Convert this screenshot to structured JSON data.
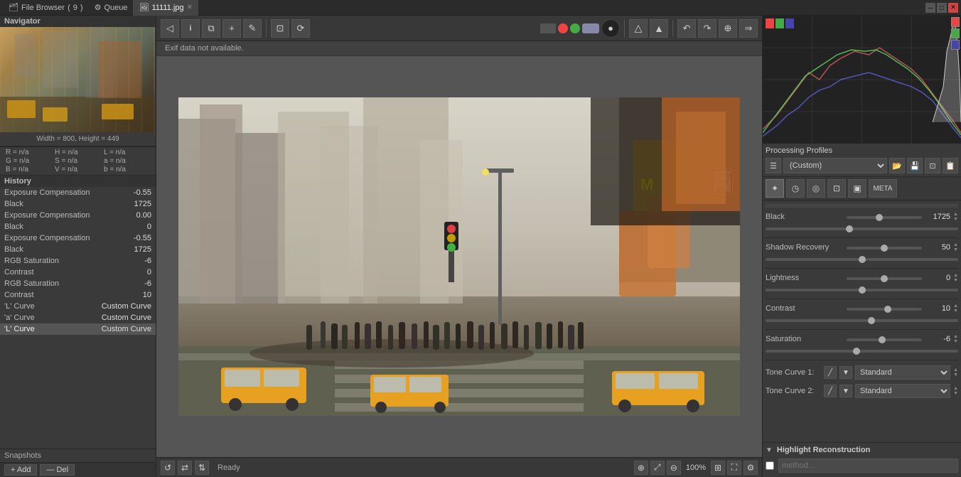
{
  "tabbar": {
    "items": [
      {
        "label": "File Browser",
        "icon": "folder-icon",
        "count": "9",
        "active": false
      },
      {
        "label": "Queue",
        "icon": "queue-icon",
        "active": false
      },
      {
        "label": "11111.jpg",
        "icon": "image-icon",
        "active": true,
        "closable": true
      }
    ]
  },
  "navigator": {
    "title": "Navigator",
    "width_label": "Width = 800, Height = 449"
  },
  "color_info": {
    "r_label": "R =",
    "r_val": "n/a",
    "h_label": "H =",
    "h_val": "n/a",
    "l_label": "L =",
    "l_val": "n/a",
    "g_label": "G =",
    "g_val": "n/a",
    "s_label": "S =",
    "s_val": "n/a",
    "a_label": "a =",
    "a_val": "n/a",
    "b_label": "B =",
    "b_val": "n/a",
    "v_label": "V =",
    "v_val": "n/a",
    "b2_label": "b =",
    "b2_val": "n/a"
  },
  "history": {
    "title": "History",
    "items": [
      {
        "label": "Exposure Compensation",
        "value": "-0.55",
        "active": false
      },
      {
        "label": "Black",
        "value": "1725",
        "active": false
      },
      {
        "label": "Exposure Compensation",
        "value": "0.00",
        "active": false
      },
      {
        "label": "Black",
        "value": "0",
        "active": false
      },
      {
        "label": "Exposure Compensation",
        "value": "-0.55",
        "active": false
      },
      {
        "label": "Black",
        "value": "1725",
        "active": false
      },
      {
        "label": "RGB Saturation",
        "value": "-6",
        "active": false
      },
      {
        "label": "Contrast",
        "value": "0",
        "active": false
      },
      {
        "label": "RGB Saturation",
        "value": "-6",
        "active": false
      },
      {
        "label": "Contrast",
        "value": "10",
        "active": false
      },
      {
        "label": "'L' Curve",
        "value": "Custom Curve",
        "active": false
      },
      {
        "label": "'a' Curve",
        "value": "Custom Curve",
        "active": false
      },
      {
        "label": "'L' Curve",
        "value": "Custom Curve",
        "active": true
      }
    ],
    "snapshots_label": "Snapshots",
    "add_btn": "+ Add",
    "del_btn": "— Del"
  },
  "toolbar": {
    "back_btn": "◁",
    "info_btn": "ℹ",
    "compare_btn": "⧉",
    "add_btn": "+",
    "edit_btn": "✎",
    "crop_btn": "⊡",
    "transform_btn": "⟳",
    "status": "Ready",
    "zoom_fit_btn": "⤢",
    "zoom_full_btn": "⊞",
    "zoom_pct": "100%"
  },
  "exif": {
    "text": "Exif data not available."
  },
  "right_panel": {
    "processing_profiles": {
      "title": "Processing Profiles",
      "current": "(Custom)"
    },
    "adjustments": {
      "black_label": "Black",
      "black_value": "1725",
      "shadow_recovery_label": "Shadow Recovery",
      "shadow_recovery_value": "50",
      "lightness_label": "Lightness",
      "lightness_value": "0",
      "contrast_label": "Contrast",
      "contrast_value": "10",
      "saturation_label": "Saturation",
      "saturation_value": "-6"
    },
    "tone_curves": {
      "curve1_label": "Tone Curve 1:",
      "curve1_option": "Standard",
      "curve2_label": "Tone Curve 2:",
      "curve2_option": "Standard"
    },
    "highlight_reconstruction": {
      "title": "Highlight Reconstruction",
      "method_placeholder": "method..."
    }
  }
}
